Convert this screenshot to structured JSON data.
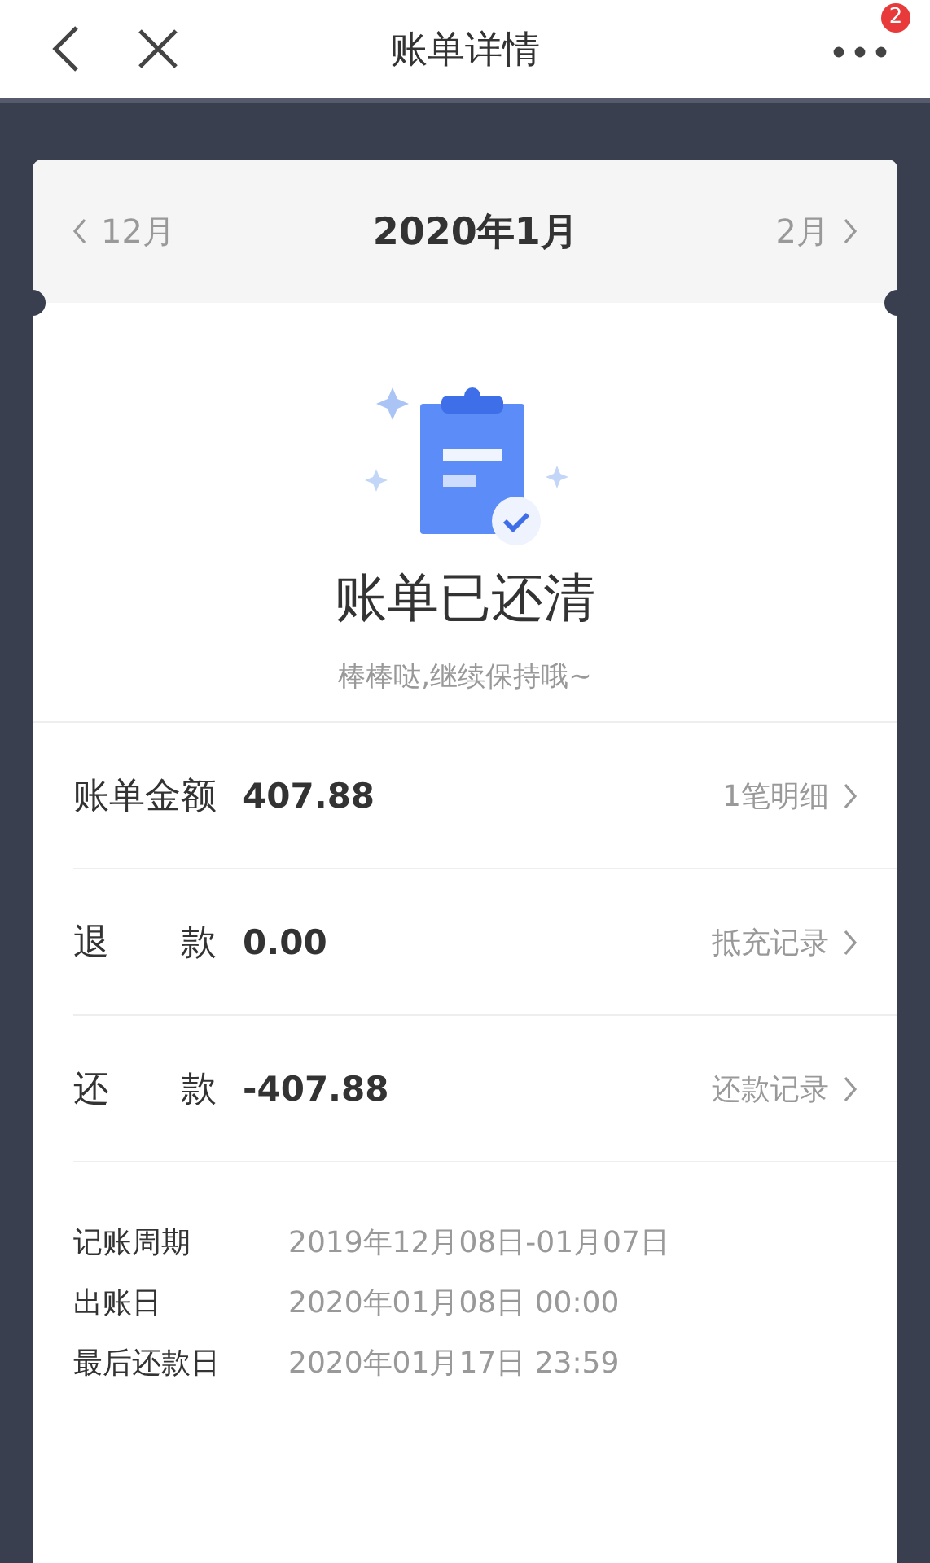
{
  "header": {
    "title": "账单详情",
    "badge": "2"
  },
  "month_nav": {
    "prev": "12月",
    "current": "2020年1月",
    "next": "2月"
  },
  "status": {
    "title": "账单已还清",
    "subtitle": "棒棒哒,继续保持哦~"
  },
  "summary_rows": [
    {
      "label": "账单金额",
      "value": "407.88",
      "link": "1笔明细"
    },
    {
      "label": "退 款",
      "value": "0.00",
      "link": "抵充记录"
    },
    {
      "label": "还 款",
      "value": "-407.88",
      "link": "还款记录"
    }
  ],
  "details": [
    {
      "label": "记账周期",
      "value": "2019年12月08日-01月07日"
    },
    {
      "label": "出账日",
      "value": "2020年01月08日 00:00"
    },
    {
      "label": "最后还款日",
      "value": "2020年01月17日 23:59"
    }
  ]
}
